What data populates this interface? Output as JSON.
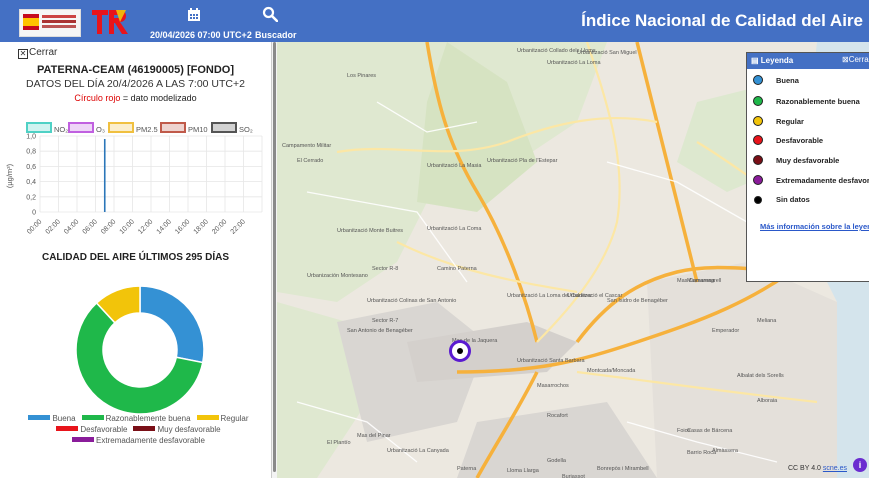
{
  "header": {
    "date_label": "20/04/2026 07:00 UTC+2",
    "search_label": "Buscador",
    "app_title": "Índice Nacional de Calidad del Aire",
    "calendar_icon": "calendar-icon",
    "search_icon": "search-icon"
  },
  "panel": {
    "close_label": "Cerrar",
    "station": "PATERNA-CEAM (46190005) [FONDO]",
    "data_day": "DATOS DEL DÍA 20/4/2026 A LAS 7:00 UTC+2",
    "modeled_red": "Círculo rojo",
    "modeled_rest": " = dato modelizado",
    "pollutants": [
      {
        "name": "NO₂",
        "color": "#4fd1c5"
      },
      {
        "name": "O₃",
        "color": "#c060e0"
      },
      {
        "name": "PM2.5",
        "color": "#f0c040"
      },
      {
        "name": "PM10",
        "color": "#c05a4a"
      },
      {
        "name": "SO₂",
        "color": "#555555"
      }
    ],
    "history_title": "CALIDAD DEL AIRE ÚLTIMOS 295 DÍAS"
  },
  "chart_data": [
    {
      "type": "line",
      "ylabel": "(µg/m³)",
      "ylim": [
        0,
        1
      ],
      "yticks": [
        "0",
        "0,2",
        "0,4",
        "0,6",
        "0,8",
        "1,0"
      ],
      "x": [
        "00:00",
        "02:00",
        "04:00",
        "06:00",
        "08:00",
        "10:00",
        "12:00",
        "14:00",
        "16:00",
        "18:00",
        "20:00",
        "22:00"
      ],
      "current_hour": "07:00",
      "series": [
        {
          "name": "NO₂",
          "values": []
        },
        {
          "name": "O₃",
          "values": []
        },
        {
          "name": "PM2.5",
          "values": []
        },
        {
          "name": "PM10",
          "values": []
        },
        {
          "name": "SO₂",
          "values": []
        }
      ],
      "grid": true,
      "legend": "top"
    },
    {
      "type": "pie",
      "title": "CALIDAD DEL AIRE ÚLTIMOS 295 DÍAS",
      "categories": [
        "Buena",
        "Razonablemente buena",
        "Regular",
        "Desfavorable",
        "Muy desfavorable",
        "Extremadamente desfavorable"
      ],
      "values": [
        83,
        177,
        35,
        0,
        0,
        0
      ],
      "colors": [
        "#3491d4",
        "#1fb84a",
        "#f2c40a",
        "#e8141b",
        "#7a0f17",
        "#8a1c9a"
      ],
      "legend": "bottom"
    }
  ],
  "legend_panel": {
    "title": "Leyenda",
    "close": "Cerrar",
    "items": [
      {
        "label": "Buena",
        "color": "#3491d4"
      },
      {
        "label": "Razonablemente buena",
        "color": "#1fb84a"
      },
      {
        "label": "Regular",
        "color": "#f2c40a"
      },
      {
        "label": "Desfavorable",
        "color": "#e8141b"
      },
      {
        "label": "Muy desfavorable",
        "color": "#7a0f17"
      },
      {
        "label": "Extremadamente desfavorable",
        "color": "#8a1c9a"
      },
      {
        "label": "Sin datos",
        "color": "#000000"
      }
    ],
    "more_info": "Más información sobre la leyenda"
  },
  "map": {
    "attribution_text": "CC BY 4.0 ",
    "attribution_link": "scne.es",
    "info_label": "i",
    "places": [
      "Los Pinares",
      "Urbanització Collado dels Lloms",
      "Urbanització La Loma",
      "Urbanització San Miguel",
      "Campamento Militar",
      "Urbanització Pla de l'Estepar",
      "El Cerrado",
      "Urbanització La Masia",
      "Urbanització La Coma",
      "Sector R-8",
      "Camino Paterna",
      "Urbanización Montesano",
      "Urbanització Colinas de San Antonio",
      "San Antonio de Benagéber",
      "Sector R-7",
      "Mas de la Jaquera",
      "Urbanització La Loma del Calderer",
      "Urbanització el Cascar",
      "San Isidro de Benagéber",
      "Mas Camarena",
      "Urbanització Santa Barbara",
      "Montcada/Moncada",
      "Masarrochos",
      "Rocafort",
      "Godella",
      "Paterna",
      "Lloma Llarga",
      "Burjassot",
      "Foios",
      "Massamagrell",
      "Emperador",
      "Meliana",
      "Barrio Roca",
      "Casas de Bárcena",
      "Albalat dels Sorells",
      "Alboraia",
      "Almàssera",
      "Bonrepòs i Mirambell",
      "El Plantío",
      "Urbanització La Canyada",
      "Mas del Pinar",
      "Urbanització Monte Buitres",
      "La Pobla de Farnals"
    ]
  }
}
